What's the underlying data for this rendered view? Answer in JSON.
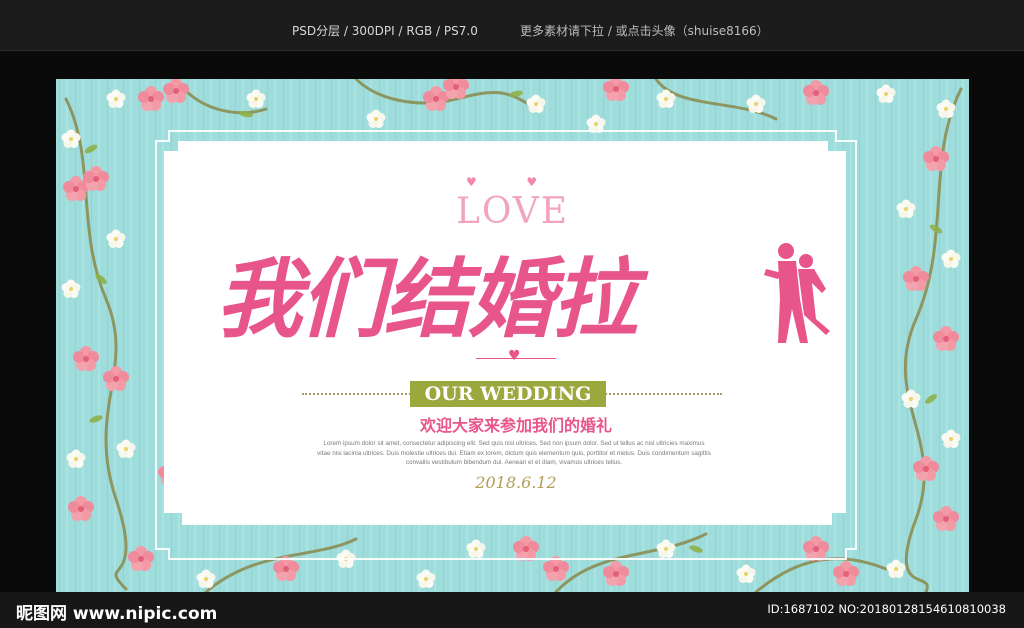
{
  "header": {
    "specs": "PSD分层 / 300DPI / RGB / PS7.0",
    "more": "更多素材请下拉 / 或点击头像（shuise8166）"
  },
  "poster": {
    "love": "LOVE",
    "title": "我们结婚拉",
    "subtitle_en": "OUR WEDDING",
    "subtitle_cn": "欢迎大家来参加我们的婚礼",
    "lorem": [
      "Lorem ipsum dolor sit amet, consectetur adipiscing elit. Sed quis nisl ultrices, Sed non ipsum dolor. Sed ut tellus ac nisl ultricies maximus",
      "vitae nisi lacinia ultrices. Duis molestie ultrices dui. Etiam ex lorem, dictum quis elementum quis, porttitor et metus. Duis condimentum sagittis",
      "convallis vestibulum bibendum dui. Aenean et et diam, vivamus ultrices tellus."
    ],
    "date": "2018.6.12"
  },
  "footer": {
    "logo": "昵图网 www.nipic.com",
    "id": "ID:1687102 NO:20180128154610810038"
  },
  "colors": {
    "background": "#0a0a0a",
    "banner_bg": "#9cdcdc",
    "title_pink": "#e8558a",
    "ribbon_green": "#9aa83e",
    "gold": "#b29d54"
  }
}
